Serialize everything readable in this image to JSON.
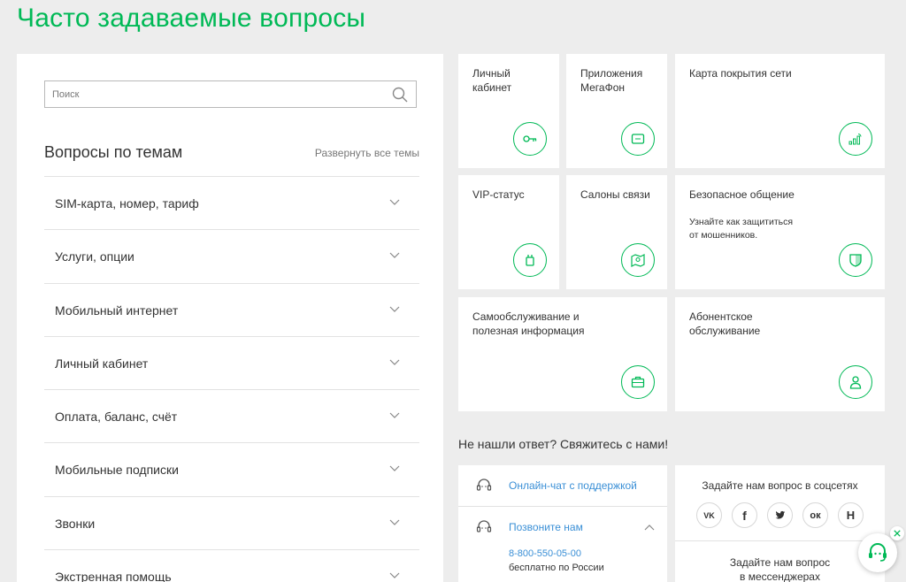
{
  "header": {
    "title": "Часто задаваемые вопросы"
  },
  "search": {
    "placeholder": "Поиск"
  },
  "topics": {
    "title": "Вопросы по темам",
    "expand_all": "Развернуть все темы",
    "items": [
      "SIM-карта, номер, тариф",
      "Услуги, опции",
      "Мобильный интернет",
      "Личный кабинет",
      "Оплата, баланс, счёт",
      "Мобильные подписки",
      "Звонки",
      "Экстренная помощь"
    ]
  },
  "tiles": [
    {
      "title": "Личный\nкабинет",
      "icon": "key-icon"
    },
    {
      "title": "Приложения\nМегаФон",
      "icon": "app-icon"
    },
    {
      "title": "Карта покрытия сети",
      "icon": "signal-icon"
    },
    {
      "title": "VIP-статус",
      "icon": "vip-badge-icon"
    },
    {
      "title": "Салоны связи",
      "icon": "map-pin-icon"
    },
    {
      "title": "Безопасное общение",
      "desc": "Узнайте как защититься\nот мошенников.",
      "icon": "shield-icon"
    },
    {
      "title": "Самообслуживание и\nполезная информация",
      "icon": "briefcase-icon"
    },
    {
      "title": "Абонентское\nобслуживание",
      "icon": "user-icon"
    }
  ],
  "contact": {
    "title": "Не нашли ответ? Свяжитесь с нами!",
    "chat_label": "Онлайн-чат с поддержкой",
    "call_label": "Позвоните нам",
    "phone": "8-800-550-05-00",
    "phone_note": "бесплатно по России",
    "social_title": "Задайте нам вопрос в соцсетях",
    "socials": [
      "vk-icon",
      "facebook-icon",
      "twitter-icon",
      "odnoklassniki-icon",
      "habr-icon"
    ],
    "social_labels": [
      "VK",
      "f",
      "",
      "ок",
      "H"
    ],
    "messenger_title": "Задайте нам вопрос\nв мессенджерах"
  },
  "colors": {
    "accent": "#00b956",
    "link": "#3a8fd6"
  }
}
